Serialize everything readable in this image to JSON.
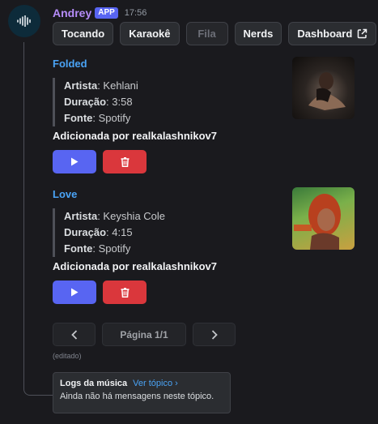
{
  "message": {
    "username": "Andrey",
    "badge": "APP",
    "timestamp": "17:56",
    "avatar_icon": "waveform-icon"
  },
  "tabs": [
    {
      "label": "Tocando",
      "disabled": false
    },
    {
      "label": "Karaokê",
      "disabled": false
    },
    {
      "label": "Fila",
      "disabled": true
    },
    {
      "label": "Nerds",
      "disabled": false
    },
    {
      "label": "Dashboard",
      "disabled": false,
      "icon": "external-link-icon"
    }
  ],
  "songs": [
    {
      "title": "Folded",
      "artist_label": "Artista",
      "artist": "Kehlani",
      "duration_label": "Duração",
      "duration": "3:58",
      "source_label": "Fonte",
      "source": "Spotify",
      "added_by": "Adicionada por realkalashnikov7"
    },
    {
      "title": "Love",
      "artist_label": "Artista",
      "artist": "Keyshia Cole",
      "duration_label": "Duração",
      "duration": "4:15",
      "source_label": "Fonte",
      "source": "Spotify",
      "added_by": "Adicionada por realkalashnikov7"
    }
  ],
  "pager": {
    "prev_icon": "chevron-left-icon",
    "page_label": "Página 1/1",
    "next_icon": "chevron-right-icon"
  },
  "edited_label": "(editado)",
  "thread": {
    "name": "Logs da música",
    "link": "Ver tópico ›",
    "empty_text": "Ainda não há mensagens neste tópico."
  },
  "colors": {
    "background": "#1a1a1e",
    "username": "#b58cf8",
    "blurple": "#5865f2",
    "danger": "#da373c",
    "link": "#4aa3f5"
  }
}
